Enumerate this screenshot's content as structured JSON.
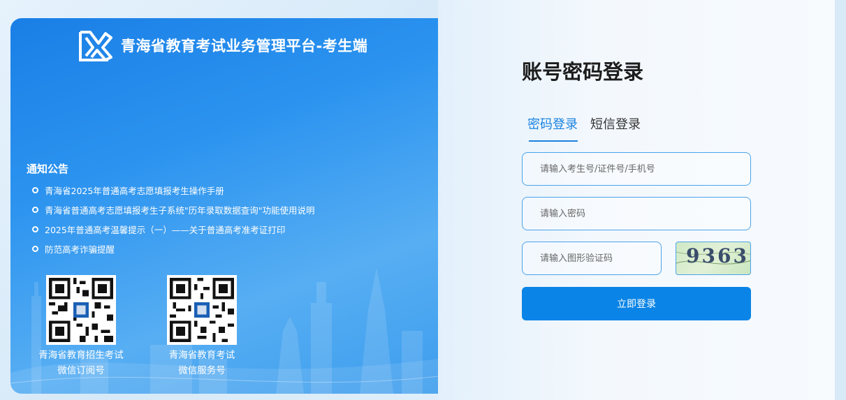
{
  "brand": {
    "title": "青海省教育考试业务管理平台-考生端",
    "logo_icon": "kj-logo-icon"
  },
  "notice": {
    "title": "通知公告",
    "items": [
      "青海省2025年普通高考志愿填报考生操作手册",
      "青海省普通高考志愿填报考生子系统\"历年录取数据查询\"功能使用说明",
      "2025年普通高考温馨提示（一）——关于普通高考准考证打印",
      "防范高考诈骗提醒"
    ]
  },
  "qr_codes": [
    {
      "caption_line1": "青海省教育招生考试",
      "caption_line2": "微信订阅号"
    },
    {
      "caption_line1": "青海省教育考试",
      "caption_line2": "微信服务号"
    }
  ],
  "login": {
    "title": "账号密码登录",
    "tabs": [
      {
        "label": "密码登录",
        "active": true
      },
      {
        "label": "短信登录",
        "active": false
      }
    ],
    "account_placeholder": "请输入考生号/证件号/手机号",
    "password_placeholder": "请输入密码",
    "captcha_placeholder": "请输入图形验证码",
    "captcha_text": "9363",
    "submit_label": "立即登录"
  },
  "colors": {
    "accent": "#0a84e6",
    "panel_blue": "#1a7fe6",
    "border": "#4aa3ea"
  }
}
